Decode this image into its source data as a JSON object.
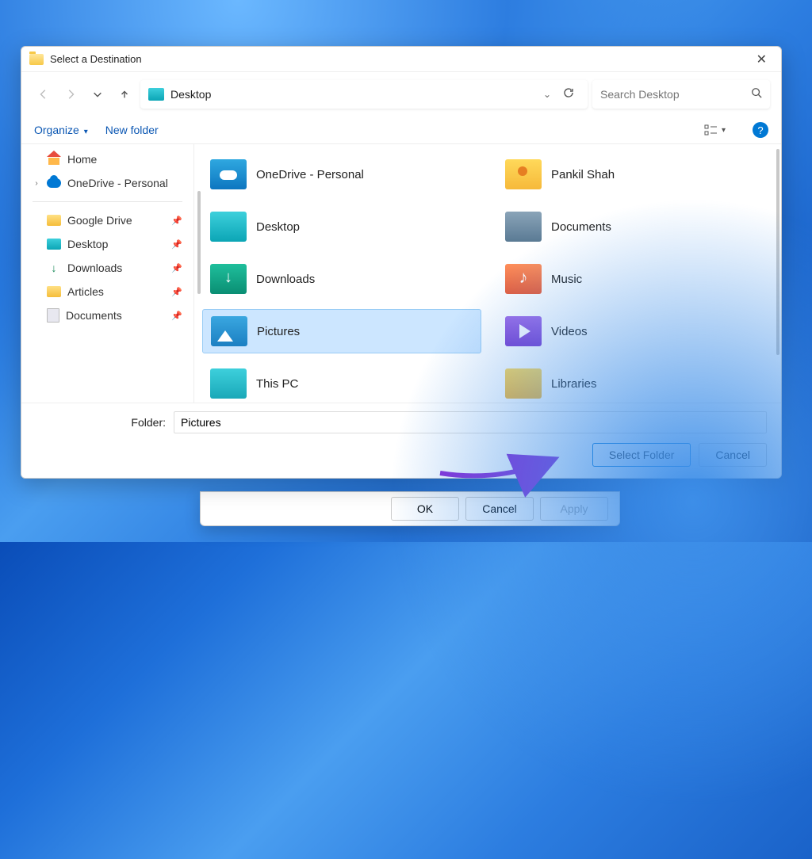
{
  "titlebar": {
    "title": "Select a Destination"
  },
  "nav": {
    "path_label": "Desktop",
    "search_placeholder": "Search Desktop"
  },
  "toolbar": {
    "organize": "Organize",
    "newfolder": "New folder"
  },
  "sidebar": {
    "home": "Home",
    "onedrive": "OneDrive - Personal",
    "pinned": [
      {
        "label": "Google Drive",
        "icon": "yfoldicon"
      },
      {
        "label": "Desktop",
        "icon": "deskicon2"
      },
      {
        "label": "Downloads",
        "icon": "dlicon"
      },
      {
        "label": "Articles",
        "icon": "yfoldicon"
      },
      {
        "label": "Documents",
        "icon": "docicon"
      }
    ]
  },
  "grid": {
    "items": [
      {
        "label": "OneDrive - Personal",
        "icon": "ic-onedrive",
        "selected": false
      },
      {
        "label": "Pankil Shah",
        "icon": "ic-user",
        "selected": false
      },
      {
        "label": "Desktop",
        "icon": "ic-desk",
        "selected": false
      },
      {
        "label": "Documents",
        "icon": "ic-docs",
        "selected": false
      },
      {
        "label": "Downloads",
        "icon": "ic-dl",
        "selected": false
      },
      {
        "label": "Music",
        "icon": "ic-music",
        "selected": false
      },
      {
        "label": "Pictures",
        "icon": "ic-pics",
        "selected": true
      },
      {
        "label": "Videos",
        "icon": "ic-vids",
        "selected": false
      },
      {
        "label": "This PC",
        "icon": "ic-pc",
        "selected": false
      },
      {
        "label": "Libraries",
        "icon": "ic-lib",
        "selected": false
      }
    ]
  },
  "footer": {
    "folder_label": "Folder:",
    "folder_value": "Pictures",
    "select": "Select Folder",
    "cancel": "Cancel"
  },
  "backdlg": {
    "ok": "OK",
    "cancel": "Cancel",
    "apply": "Apply"
  }
}
